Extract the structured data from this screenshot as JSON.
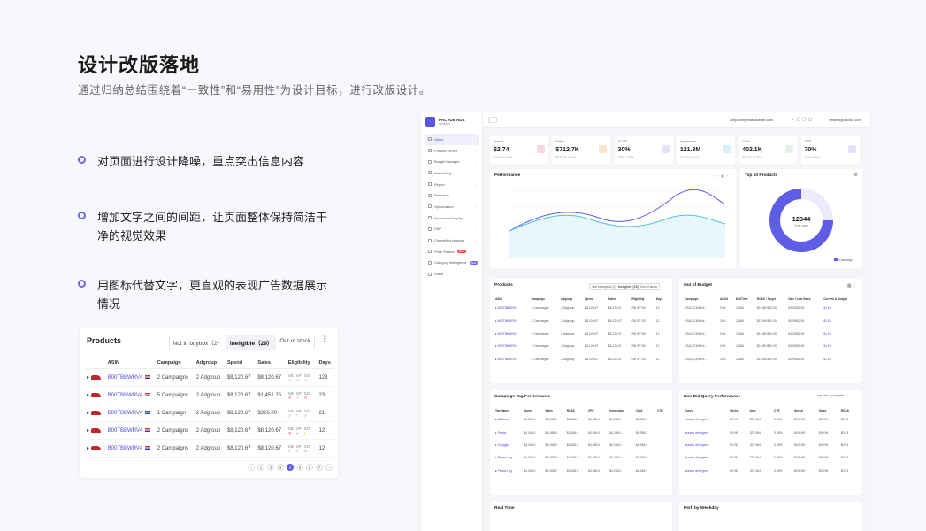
{
  "heading": "设计改版落地",
  "subtitle": "通过归纳总结围绕着“一致性”和“易用性”为设计目标，进行改版设计。",
  "bullets": [
    "对页面进行设计降噪，重点突出信息内容",
    "增加文字之间的间距，让页面整体保持简洁干净的视觉效果",
    "用图标代替文字，更直观的表现广告数据展示情况"
  ],
  "products_card": {
    "title": "Products",
    "filters": [
      "Not in buybox（2）",
      "Ineligible（29）",
      "Out of stock"
    ],
    "columns": [
      "ASIN",
      "Campaign",
      "Adgroup",
      "Spend",
      "Sales",
      "Eligibility",
      "Days"
    ],
    "rows": [
      {
        "asin": "B00TBBWRV4",
        "campaign": "2 Campaigns",
        "adgroup": "2 Adgroup",
        "spend": "$8,120.67",
        "sales": "$8,120.67",
        "days": "123"
      },
      {
        "asin": "B00TBBWRV4",
        "campaign": "5 Campaigns",
        "adgroup": "2 Adgroup",
        "spend": "$8,120.67",
        "sales": "$1,451.25",
        "days": "23"
      },
      {
        "asin": "B00TBBWRV4",
        "campaign": "1 Campaign",
        "adgroup": "2 Adgroup",
        "spend": "$8,120.67",
        "sales": "$326.00",
        "days": "21"
      },
      {
        "asin": "B00TBBWRV4",
        "campaign": "2 Campaigns",
        "adgroup": "2 Adgroup",
        "spend": "$8,120.67",
        "sales": "$8,120.67",
        "days": "12"
      },
      {
        "asin": "B00TBBWRV4",
        "campaign": "2 Campaigns",
        "adgroup": "2 Adgroup",
        "spend": "$8,120.67",
        "sales": "$8,120.67",
        "days": "12"
      }
    ],
    "elig_labels": [
      "SB",
      "SP",
      "SD"
    ],
    "pages": [
      "1",
      "2",
      "3",
      "4",
      "5",
      "6",
      "7"
    ],
    "current_page": "4"
  },
  "dashboard": {
    "brand": "PACVUE ADS",
    "brand_sub": "Amazon",
    "email": "amy.wolf@vitalcouture.com",
    "email2": "tenbel@pacvue.com",
    "nav": [
      "Home",
      "Product Center",
      "Budget Manager",
      "Advertising",
      "Report",
      "Research",
      "Optimization",
      "Sponsored Display",
      "DSP",
      "Competitor Analysis",
      "Price Tracker",
      "Category Intelligence",
      "Event"
    ],
    "kpis": [
      {
        "label": "Spend",
        "value": "$2.74",
        "delta": "$2.69  +0.00%",
        "color": "#f7dada"
      },
      {
        "label": "Sales",
        "value": "$712.7K",
        "delta": "$678.5K  +5.0%",
        "color": "#fbe6c8"
      },
      {
        "label": "ACOS",
        "value": "30%",
        "delta": "32%  -2.00%",
        "color": "#e4e3fb"
      },
      {
        "label": "Impression",
        "value": "121.3M",
        "delta": "111.1M  +9.17%",
        "color": "#d8f0fa"
      },
      {
        "label": "Click",
        "value": "402.1K",
        "delta": "396.2K  +1.5%",
        "color": "#dff4e4"
      },
      {
        "label": "CTR",
        "value": "70%",
        "delta": "72%  +0.5%",
        "color": "#e4e3fb"
      }
    ],
    "performance_title": "Performance",
    "top10_title": "Top 10 Products",
    "top10_total": "12344",
    "top10_total_label": "Total sales",
    "top10_legend": "Campaign",
    "mini_products_title": "Products",
    "out_of_budget_title": "Out of Budget",
    "campaign_tag_title": "Campaign Tag Performance",
    "nonbid_title": "Non Bid Query Performance",
    "realtime_title": "Real Time",
    "weekday_title": "Perf. by Weekday"
  }
}
